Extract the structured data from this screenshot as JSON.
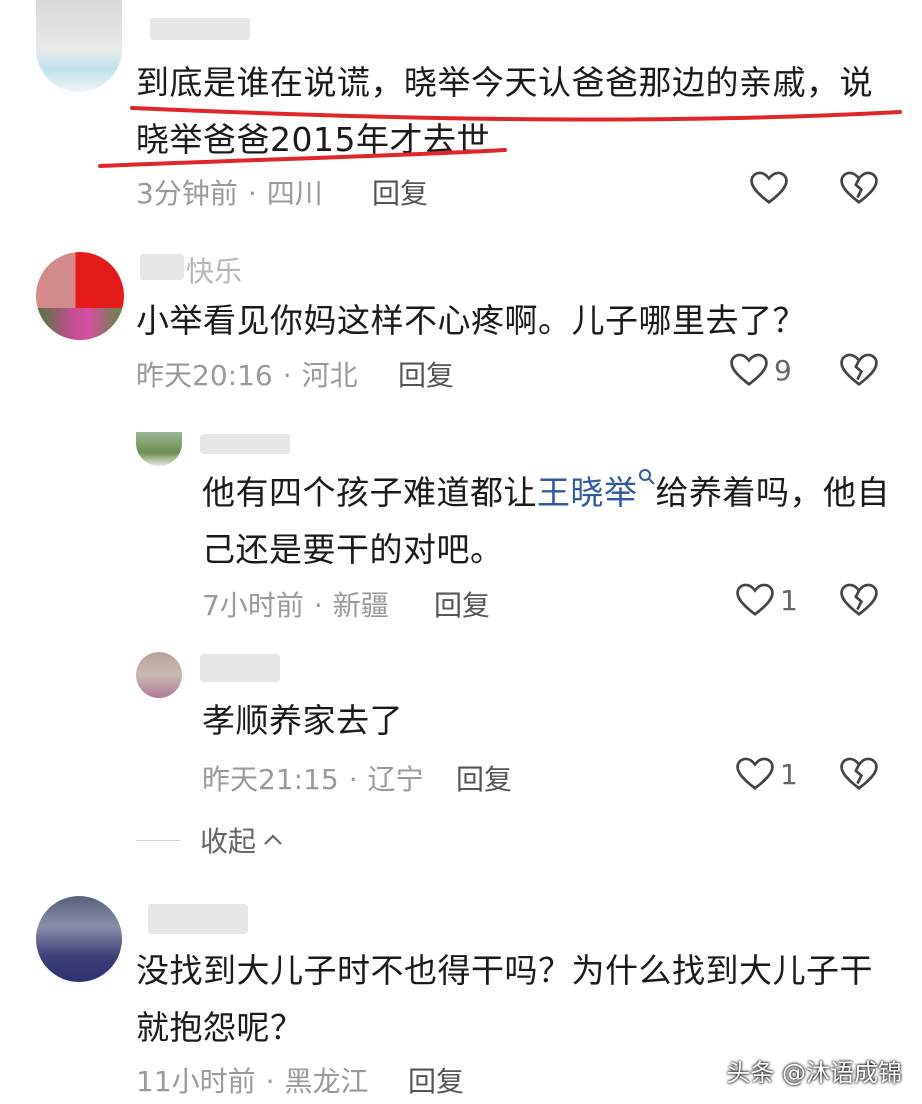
{
  "comments": [
    {
      "text": "到底是谁在说谎，晓举今天认爸爸那边的亲戚，说晓举爸爸2015年才去世",
      "time": "3分钟前",
      "location": "四川",
      "reply_label": "回复",
      "likes": ""
    },
    {
      "username": "快乐",
      "text": "小举看见你妈这样不心疼啊。儿子哪里去了？",
      "time": "昨天20:16",
      "location": "河北",
      "reply_label": "回复",
      "likes": "9",
      "replies": [
        {
          "text_before": "他有四个孩子难道都让",
          "mention": "王晓举",
          "text_after": "给养着吗，他自己还是要干的对吧。",
          "time": "7小时前",
          "location": "新疆",
          "reply_label": "回复",
          "likes": "1"
        },
        {
          "text": "孝顺养家去了",
          "time": "昨天21:15",
          "location": "辽宁",
          "reply_label": "回复",
          "likes": "1"
        }
      ],
      "collapse_label": "收起"
    },
    {
      "text": "没找到大儿子时不也得干吗？为什么找到大儿子干就抱怨呢？",
      "time": "11小时前",
      "location": "黑龙江",
      "reply_label": "回复",
      "likes": ""
    }
  ],
  "separator": "·",
  "watermark": "头条 @沐语成锦",
  "colors": {
    "underline": "#e0262a",
    "mention": "#2f5aa0",
    "meta": "#9a9a9a"
  }
}
